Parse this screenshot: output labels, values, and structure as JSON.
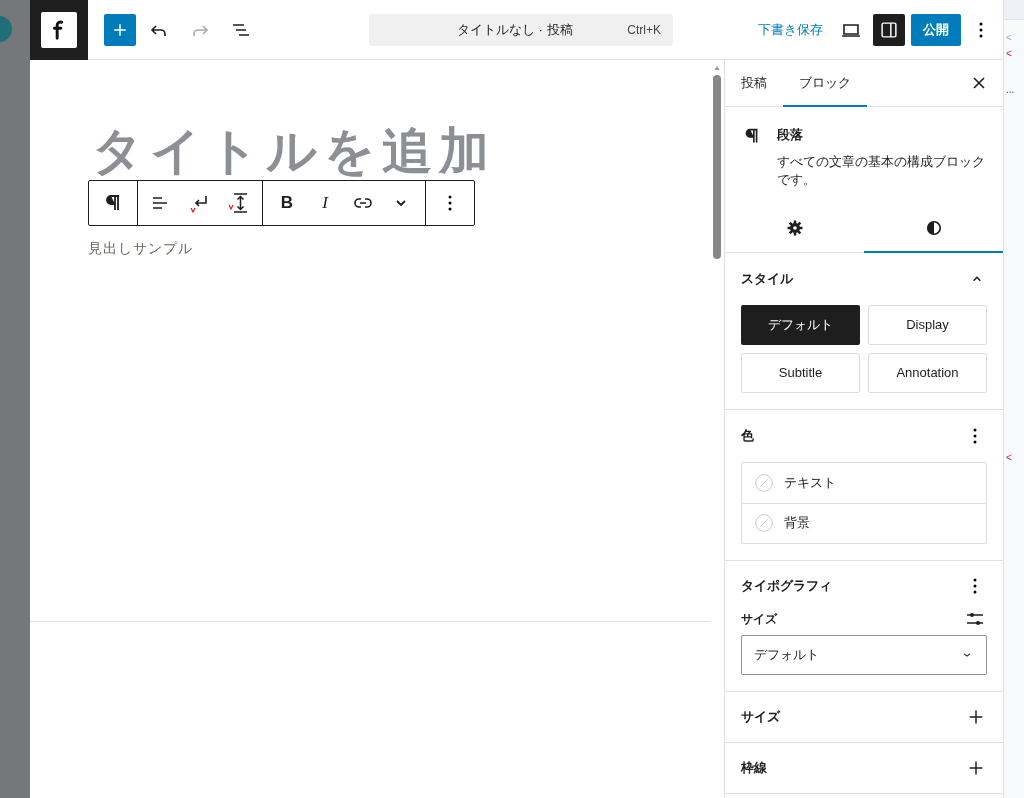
{
  "header": {
    "command_bar": {
      "title": "タイトルなし · 投稿",
      "shortcut": "Ctrl+K"
    },
    "save_draft": "下書き保存",
    "settings_toggle": {
      "on": true
    },
    "publish": "公開"
  },
  "editor": {
    "title_placeholder": "タイトルを追加",
    "paragraph": "見出しサンプル",
    "toolbar": {
      "bold": "B",
      "italic": "I"
    }
  },
  "sidebar": {
    "tabs": [
      {
        "label": "投稿",
        "selected": false
      },
      {
        "label": "ブロック",
        "selected": true
      }
    ],
    "block": {
      "name": "段落",
      "description": "すべての文章の基本の構成ブロックです。"
    },
    "subtabs": [
      {
        "kind": "settings",
        "selected": false
      },
      {
        "kind": "styles",
        "selected": true
      }
    ],
    "styles": {
      "title": "スタイル",
      "expanded": true,
      "options": [
        {
          "label": "デフォルト",
          "selected": true
        },
        {
          "label": "Display",
          "selected": false
        },
        {
          "label": "Subtitle",
          "selected": false
        },
        {
          "label": "Annotation",
          "selected": false
        }
      ]
    },
    "color": {
      "title": "色",
      "items": [
        "テキスト",
        "背景"
      ]
    },
    "typography": {
      "title": "タイポグラフィ",
      "size_label": "サイズ",
      "size_value": "デフォルト"
    },
    "panels": [
      {
        "title": "サイズ",
        "expanded": false
      },
      {
        "title": "枠線",
        "expanded": false
      }
    ]
  },
  "devtools": {
    "lines": [
      "<",
      "<",
      "...",
      "<"
    ]
  }
}
